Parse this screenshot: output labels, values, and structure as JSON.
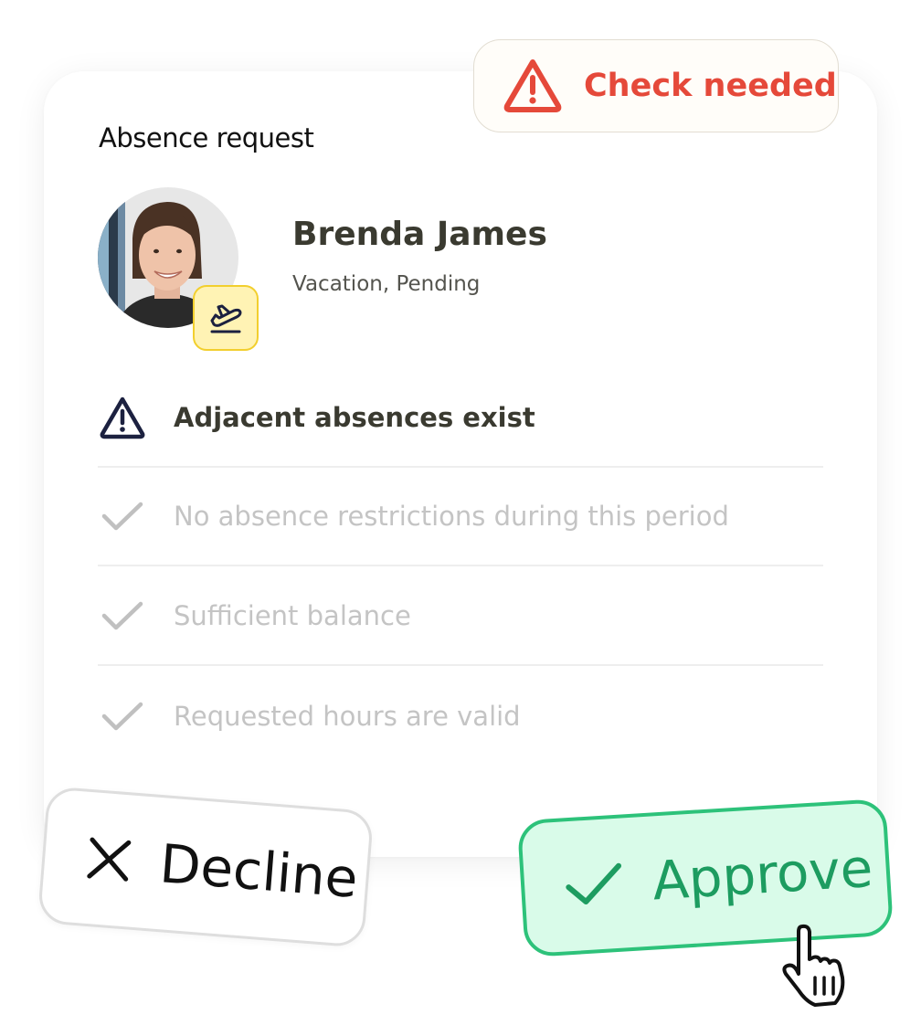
{
  "status_badge": {
    "label": "Check needed",
    "icon": "warning-triangle-icon",
    "color": "#e5493a"
  },
  "card": {
    "title": "Absence request"
  },
  "employee": {
    "name": "Brenda James",
    "status": "Vacation, Pending",
    "badge_icon": "airplane-takeoff-icon"
  },
  "checks": [
    {
      "label": "Adjacent absences exist",
      "state": "warning",
      "icon": "warning-triangle-icon"
    },
    {
      "label": "No absence restrictions during this period",
      "state": "passed",
      "icon": "checkmark-icon"
    },
    {
      "label": "Sufficient balance",
      "state": "passed",
      "icon": "checkmark-icon"
    },
    {
      "label": "Requested hours are valid",
      "state": "passed",
      "icon": "checkmark-icon"
    }
  ],
  "actions": {
    "decline_label": "Decline",
    "approve_label": "Approve"
  },
  "colors": {
    "approve_accent": "#2dc27a",
    "approve_background": "#d9fbe9",
    "flight_badge": "#fff3b4",
    "warning_icon": "#1c2140"
  }
}
